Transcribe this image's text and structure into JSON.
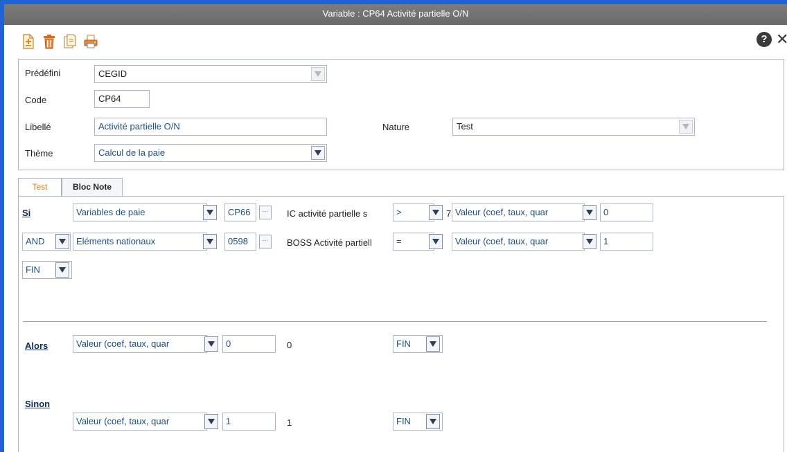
{
  "window": {
    "title": "Variable : CP64 Activité partielle O/N"
  },
  "toolbar": {
    "icons": [
      "new-document-icon",
      "delete-icon",
      "copy-icon",
      "print-icon"
    ],
    "help_label": "?",
    "close_label": "✕"
  },
  "header": {
    "predefini": {
      "label": "Prédéfini",
      "value": "CEGID"
    },
    "code": {
      "label": "Code",
      "value": "CP64"
    },
    "libelle": {
      "label": "Libellé",
      "value": "Activité partielle O/N"
    },
    "theme": {
      "label": "Thème",
      "value": "Calcul de la paie"
    },
    "nature": {
      "label": "Nature",
      "value": "Test"
    }
  },
  "tabs": [
    {
      "label": "Test",
      "active": true
    },
    {
      "label": "Bloc Note",
      "active": false
    }
  ],
  "si": {
    "title": "Si",
    "row1": {
      "source": "Variables de paie",
      "code": "CP66",
      "description": "IC activité partielle s",
      "operator": ">",
      "extra": "7",
      "value_type": "Valeur (coef, taux, quar",
      "value": "0"
    },
    "row2": {
      "connector": "AND",
      "source": "Eléments nationaux",
      "code": "0598",
      "description": "BOSS Activité partiell",
      "operator": "=",
      "value_type": "Valeur (coef, taux, quar",
      "value": "1"
    },
    "row3": {
      "connector": "FIN"
    }
  },
  "alors": {
    "title": "Alors",
    "value_type": "Valeur (coef, taux, quar",
    "value": "0",
    "result": "0",
    "end": "FIN"
  },
  "sinon": {
    "title": "Sinon",
    "value_type": "Valeur (coef, taux, quar",
    "value": "1",
    "result": "1",
    "end": "FIN"
  },
  "colors": {
    "frame_blue": "#1e62d8",
    "titlebar_gray": "#6f6f6f",
    "active_tab_orange": "#e07b12",
    "field_text_blue": "#1f4f7f"
  }
}
